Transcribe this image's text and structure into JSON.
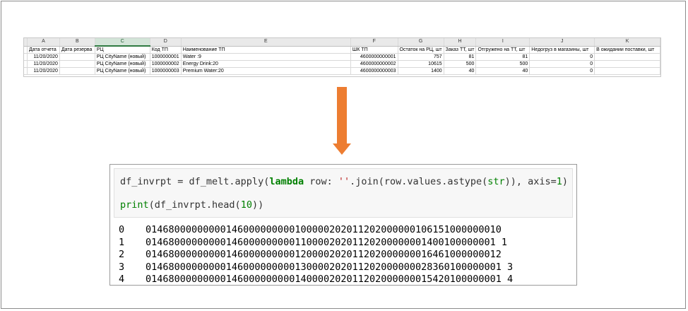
{
  "sheet": {
    "column_letters": [
      "",
      "A",
      "B",
      "C",
      "D",
      "E",
      "F",
      "G",
      "H",
      "I",
      "J",
      "K"
    ],
    "header": [
      "",
      "Дата отчета",
      "Дата резерва",
      "РЦ",
      "Код ТП",
      "Наименование ТП",
      "ШК ТП",
      "Остаток на РЦ, шт",
      "Заказ ТТ, шт",
      "Отгружено на ТТ, шт",
      "Недогруз в магазины, шт",
      "В ожидании поставки, шт"
    ],
    "rows": [
      [
        "",
        "11/20/2020",
        "",
        "РЦ CityName (новый)",
        "1000000001",
        "Water :9",
        "4600000000001",
        "757",
        "81",
        "81",
        "0",
        ""
      ],
      [
        "",
        "11/20/2020",
        "",
        "РЦ CityName (новый)",
        "1000000002",
        "Energy Drink:20",
        "4600000000002",
        "10615",
        "500",
        "500",
        "0",
        ""
      ],
      [
        "",
        "11/20/2020",
        "",
        "РЦ CityName (новый)",
        "1000000003",
        "Premium Water:20",
        "4600000000003",
        "1400",
        "40",
        "40",
        "0",
        ""
      ]
    ]
  },
  "arrow": {
    "color": "#ed7d31"
  },
  "code": {
    "line1": {
      "a": "df_invrpt = df_melt.apply(",
      "kw": "lambda",
      "b": " row: ",
      "str": "''",
      "c": ".join(row.values.astype(",
      "bi": "str",
      "d": ")), axis=",
      "num": "1",
      "e": ")"
    },
    "line2": {
      "fn": "print",
      "a": "(df_invrpt.head(",
      "num": "10",
      "b": "))"
    }
  },
  "output": [
    {
      "index": "0",
      "value": "01468000000000146000000000100000202011202000000106151000000010"
    },
    {
      "index": "1",
      "value": "0146800000000014600000000011000020201120200000001400100000001 1"
    },
    {
      "index": "2",
      "value": "01468000000000146000000000120000202011202000000016461000000012"
    },
    {
      "index": "3",
      "value": "01468000000000146000000000130000202011202000000028360100000001 3"
    },
    {
      "index": "4",
      "value": "01468000000000146000000000140000202011202000000015420100000001 4"
    }
  ]
}
